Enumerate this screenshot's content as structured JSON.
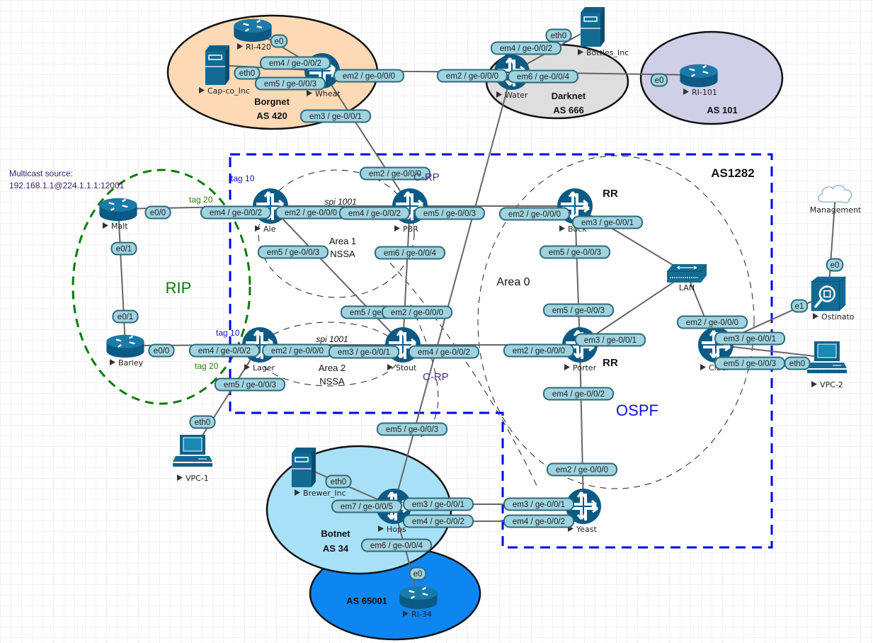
{
  "colors": {
    "grid": "#e6e6e6",
    "device": "#0b5a86",
    "device_light": "#1a7aa8",
    "iface_fill": "#9fd3df",
    "iface_stroke": "#2f6a7a",
    "link": "#666666",
    "as1282_border": "#0000ee",
    "rip_border": "#0a7a0a",
    "tag10": "#1010dd",
    "tag20": "#2e7d12",
    "crp": "#4a2f8a",
    "multicast_text": "#3a1a6a",
    "borgnet_fill": "#fdd9b6",
    "darknet_fill": "#dedede",
    "as101_fill": "#cfcfe8",
    "botnet_fill": "#a8e0f7",
    "as65001_fill": "#0d86f2"
  },
  "zones": {
    "borgnet": {
      "name": "Borgnet",
      "as": "AS 420"
    },
    "darknet": {
      "name": "Darknet",
      "as": "AS 666"
    },
    "as101": {
      "as": "AS 101"
    },
    "botnet": {
      "name": "Botnet",
      "as": "AS 34"
    },
    "as65001": {
      "as": "AS 65001"
    },
    "as1282": {
      "label": "AS1282"
    },
    "rip": {
      "label": "RIP"
    },
    "ospf": {
      "label": "OSPF"
    },
    "area0": {
      "label": "Area 0"
    },
    "area1": {
      "line1": "Area 1",
      "line2": "NSSA",
      "spi": "spi 1001"
    },
    "area2": {
      "line1": "Area 2",
      "line2": "NSSA",
      "spi": "spi 1001"
    }
  },
  "annotations": {
    "multicast_line1": "Multicast source:",
    "multicast_line2": "192.168.1.1@224.1.1.1:12001",
    "ale_tag10": "tag 10",
    "ale_tag20": "tag 20",
    "lager_tag10": "tag 10",
    "lager_tag20": "tag 20",
    "pbr_crp": "C-RP",
    "stout_crp": "C-RP",
    "bock_rr": "RR",
    "porter_rr": "RR"
  },
  "nodes": [
    {
      "id": "ri420",
      "label": "RI-420",
      "type": "cisco-router"
    },
    {
      "id": "capco",
      "label": "Cap-co_Inc",
      "type": "server"
    },
    {
      "id": "wheat",
      "label": "Wheat",
      "type": "juniper-router"
    },
    {
      "id": "water",
      "label": "Water",
      "type": "juniper-router"
    },
    {
      "id": "bottles",
      "label": "Bottles_Inc",
      "type": "server"
    },
    {
      "id": "ri101",
      "label": "RI-101",
      "type": "cisco-router"
    },
    {
      "id": "malt",
      "label": "Malt",
      "type": "cisco-router"
    },
    {
      "id": "barley",
      "label": "Barley",
      "type": "cisco-router"
    },
    {
      "id": "ale",
      "label": "Ale",
      "type": "juniper-router"
    },
    {
      "id": "pbr",
      "label": "PBR",
      "type": "juniper-router"
    },
    {
      "id": "bock",
      "label": "Bock",
      "type": "juniper-router"
    },
    {
      "id": "lan",
      "label": "LAN",
      "type": "switch"
    },
    {
      "id": "lager",
      "label": "Lager",
      "type": "juniper-router"
    },
    {
      "id": "stout",
      "label": "Stout",
      "type": "juniper-router"
    },
    {
      "id": "porter",
      "label": "Porter",
      "type": "juniper-router"
    },
    {
      "id": "cider",
      "label": "Cider",
      "type": "juniper-router"
    },
    {
      "id": "management",
      "label": "Management",
      "type": "cloud"
    },
    {
      "id": "ostinato",
      "label": "Ostinato",
      "type": "traffic-generator"
    },
    {
      "id": "vpc2",
      "label": "VPC-2",
      "type": "pc"
    },
    {
      "id": "vpc1",
      "label": "VPC-1",
      "type": "pc"
    },
    {
      "id": "brewer",
      "label": "Brewer_Inc",
      "type": "server"
    },
    {
      "id": "hops",
      "label": "Hops",
      "type": "juniper-router"
    },
    {
      "id": "yeast",
      "label": "Yeast",
      "type": "juniper-router"
    },
    {
      "id": "ri34",
      "label": "RI-34",
      "type": "cisco-router"
    }
  ],
  "links": [
    {
      "a": "ri420",
      "a_if": "e0",
      "b": "wheat",
      "b_if": "em4 / ge-0/0/2"
    },
    {
      "a": "capco",
      "a_if": "eth0",
      "b": "wheat",
      "b_if": "em5 / ge-0/0/3"
    },
    {
      "a": "wheat",
      "a_if": "em2 / ge-0/0/0",
      "b": "water",
      "b_if": "em2 / ge-0/0/0"
    },
    {
      "a": "water",
      "a_if": "em4 / ge-0/0/2",
      "b": "bottles",
      "b_if": "eth0"
    },
    {
      "a": "water",
      "a_if": "em6 / ge-0/0/4",
      "b": "ri101",
      "b_if": "e0"
    },
    {
      "a": "wheat",
      "a_if": "em3 / ge-0/0/1",
      "b": "pbr",
      "b_if": "em2 / ge-0/0/0"
    },
    {
      "a": "water",
      "a_if": "",
      "b": "hops",
      "b_if": "em5 / ge-0/0/3"
    },
    {
      "a": "malt",
      "a_if": "e0/0",
      "b": "ale",
      "b_if": "em4 / ge-0/0/2"
    },
    {
      "a": "malt",
      "a_if": "e0/1",
      "b": "barley",
      "b_if": "e0/1"
    },
    {
      "a": "barley",
      "a_if": "e0/0",
      "b": "lager",
      "b_if": "em4 / ge-0/0/2"
    },
    {
      "a": "ale",
      "a_if": "em2 / ge-0/0/0",
      "b": "pbr",
      "b_if": "em4 / ge-0/0/2"
    },
    {
      "a": "ale",
      "a_if": "em5 / ge-0/0/3",
      "b": "stout",
      "b_if": "em5 / ge-0/0/3"
    },
    {
      "a": "pbr",
      "a_if": "em5 / ge-0/0/3",
      "b": "bock",
      "b_if": "em2 / ge-0/0/0"
    },
    {
      "a": "pbr",
      "a_if": "em6 / ge-0/0/4",
      "b": "stout",
      "b_if": "em2 / ge-0/0/0"
    },
    {
      "a": "bock",
      "a_if": "em3 / ge-0/0/1",
      "b": "lan",
      "b_if": ""
    },
    {
      "a": "bock",
      "a_if": "em5 / ge-0/0/3",
      "b": "porter",
      "b_if": "em5 / ge-0/0/3"
    },
    {
      "a": "lager",
      "a_if": "em2 / ge-0/0/0",
      "b": "stout",
      "b_if": "em3 / ge-0/0/1"
    },
    {
      "a": "lager",
      "a_if": "em5 / ge-0/0/3",
      "b": "vpc1",
      "b_if": "eth0"
    },
    {
      "a": "stout",
      "a_if": "em4 / ge-0/0/2",
      "b": "porter",
      "b_if": "em2 / ge-0/0/0"
    },
    {
      "a": "porter",
      "a_if": "em3 / ge-0/0/1",
      "b": "lan",
      "b_if": ""
    },
    {
      "a": "porter",
      "a_if": "em4 / ge-0/0/2",
      "b": "yeast",
      "b_if": "em2 / ge-0/0/0"
    },
    {
      "a": "lan",
      "a_if": "",
      "b": "cider",
      "b_if": "em2 / ge-0/0/0"
    },
    {
      "a": "cider",
      "a_if": "em3 / ge-0/0/1",
      "b": "ostinato",
      "b_if": "e1"
    },
    {
      "a": "cider",
      "a_if": "em5 / ge-0/0/3",
      "b": "vpc2",
      "b_if": "eth0"
    },
    {
      "a": "management",
      "a_if": "",
      "b": "ostinato",
      "b_if": "e0"
    },
    {
      "a": "brewer",
      "a_if": "eth0",
      "b": "hops",
      "b_if": "em7 / ge-0/0/5"
    },
    {
      "a": "hops",
      "a_if": "em3 / ge-0/0/1",
      "b": "yeast",
      "b_if": "em3 / ge-0/0/1"
    },
    {
      "a": "hops",
      "a_if": "em4 / ge-0/0/2",
      "b": "yeast",
      "b_if": "em4 / ge-0/0/2"
    },
    {
      "a": "hops",
      "a_if": "em6 / ge-0/0/4",
      "b": "ri34",
      "b_if": "e0"
    }
  ]
}
